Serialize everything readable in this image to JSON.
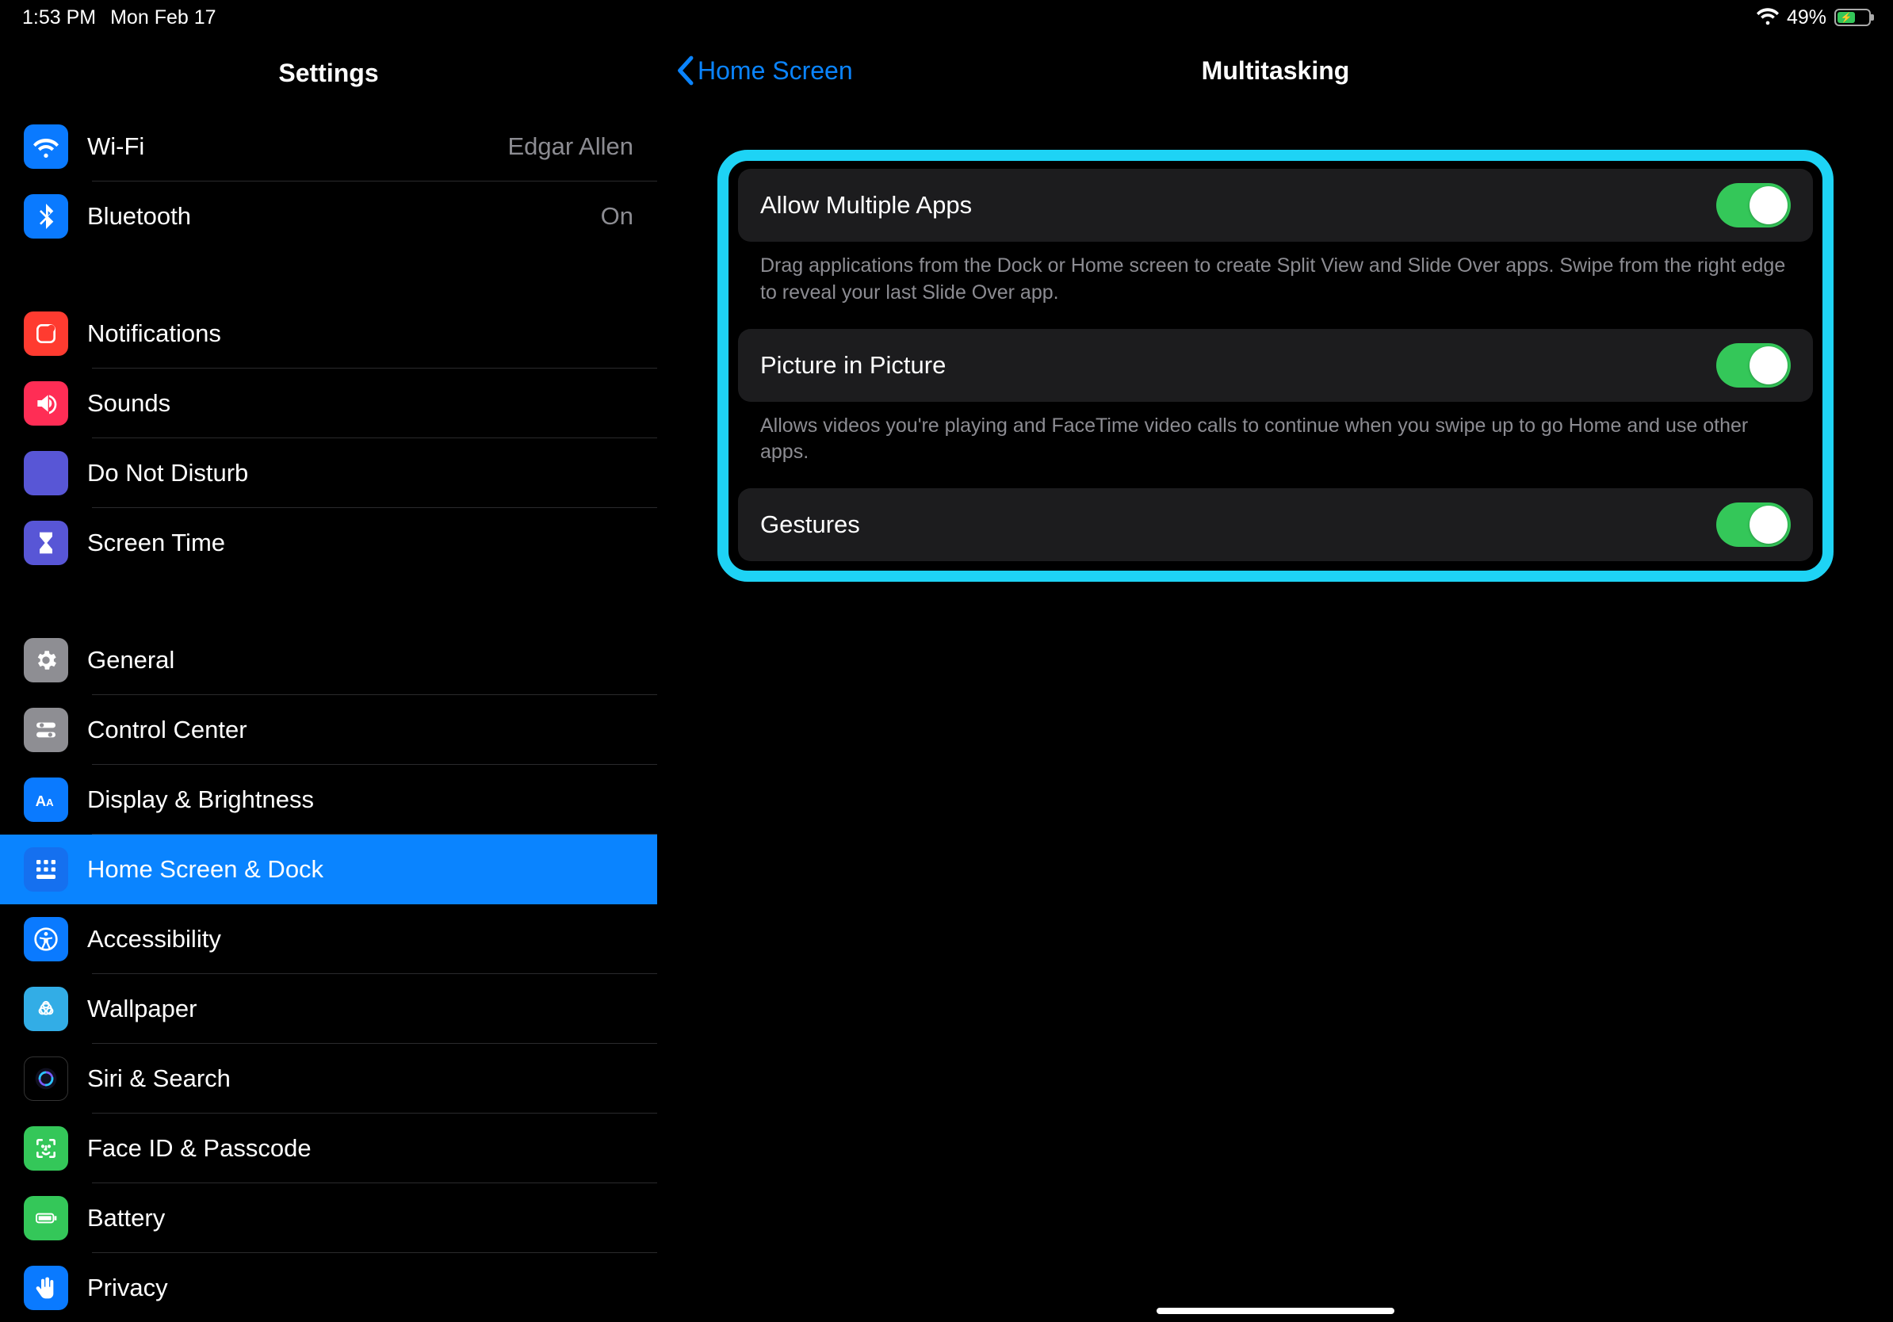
{
  "status": {
    "time": "1:53 PM",
    "date": "Mon Feb 17",
    "battery_pct": "49%",
    "battery_fill_pct": 49
  },
  "sidebar": {
    "title": "Settings",
    "groups": [
      [
        {
          "icon": "wifi-icon",
          "icon_bg": "bg-blue",
          "label": "Wi-Fi",
          "value": "Edgar Allen"
        },
        {
          "icon": "bluetooth-icon",
          "icon_bg": "bg-blue",
          "label": "Bluetooth",
          "value": "On"
        }
      ],
      [
        {
          "icon": "notifications-icon",
          "icon_bg": "bg-red",
          "label": "Notifications"
        },
        {
          "icon": "sounds-icon",
          "icon_bg": "bg-pink",
          "label": "Sounds"
        },
        {
          "icon": "moon-icon",
          "icon_bg": "bg-purple",
          "label": "Do Not Disturb"
        },
        {
          "icon": "hourglass-icon",
          "icon_bg": "bg-purple",
          "label": "Screen Time"
        }
      ],
      [
        {
          "icon": "gear-icon",
          "icon_bg": "bg-gray",
          "label": "General"
        },
        {
          "icon": "toggles-icon",
          "icon_bg": "bg-gray",
          "label": "Control Center"
        },
        {
          "icon": "text-size-icon",
          "icon_bg": "bg-blue",
          "label": "Display & Brightness"
        },
        {
          "icon": "home-dock-icon",
          "icon_bg": "bg-dock",
          "label": "Home Screen & Dock",
          "selected": true
        },
        {
          "icon": "accessibility-icon",
          "icon_bg": "bg-blue",
          "label": "Accessibility"
        },
        {
          "icon": "wallpaper-icon",
          "icon_bg": "bg-cyan",
          "label": "Wallpaper"
        },
        {
          "icon": "siri-icon",
          "icon_bg": "bg-black",
          "label": "Siri & Search"
        },
        {
          "icon": "faceid-icon",
          "icon_bg": "bg-green",
          "label": "Face ID & Passcode"
        },
        {
          "icon": "battery-icon",
          "icon_bg": "bg-green",
          "label": "Battery"
        },
        {
          "icon": "hand-icon",
          "icon_bg": "bg-blue",
          "label": "Privacy"
        }
      ]
    ]
  },
  "detail": {
    "back_label": "Home Screen",
    "title": "Multitasking",
    "items": [
      {
        "label": "Allow Multiple Apps",
        "on": true,
        "footer": "Drag applications from the Dock or Home screen to create Split View and Slide Over apps. Swipe from the right edge to reveal your last Slide Over app."
      },
      {
        "label": "Picture in Picture",
        "on": true,
        "footer": "Allows videos you're playing and FaceTime video calls to continue when you swipe up to go Home and use other apps."
      },
      {
        "label": "Gestures",
        "on": true
      }
    ]
  }
}
